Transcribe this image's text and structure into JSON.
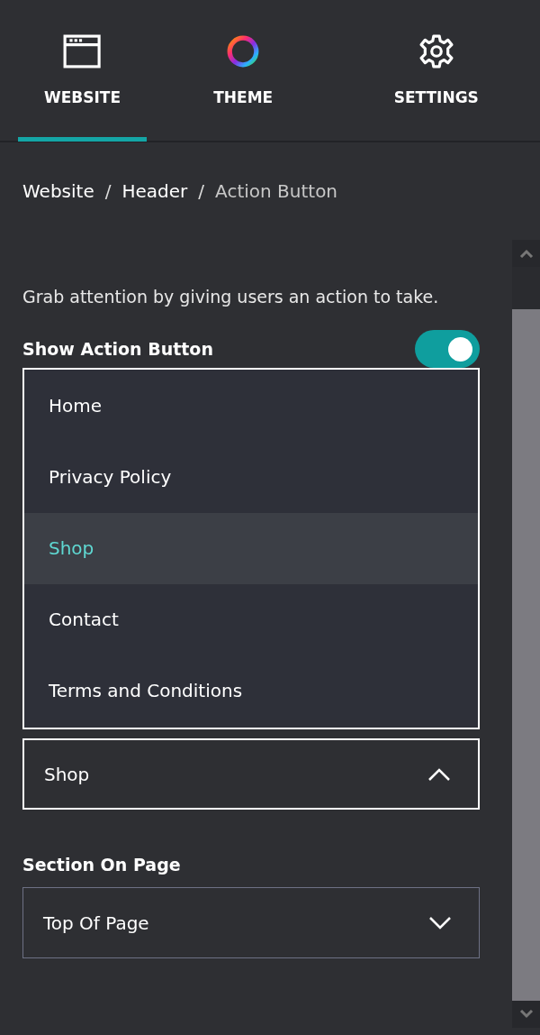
{
  "tabs": [
    {
      "label": "WEBSITE",
      "selected": true
    },
    {
      "label": "THEME",
      "selected": false
    },
    {
      "label": "SETTINGS",
      "selected": false
    }
  ],
  "breadcrumb": [
    {
      "label": "Website"
    },
    {
      "separator": "/",
      "label": "Header"
    },
    {
      "separator": "/",
      "label": "Action Button"
    }
  ],
  "description": "Grab attention by giving users an action to take.",
  "toggle": {
    "label": "Show Action Button",
    "on": true
  },
  "link_dropdown": {
    "expanded": true,
    "value": "Shop",
    "options": [
      {
        "label": "Home",
        "selected": false
      },
      {
        "label": "Privacy Policy",
        "selected": false
      },
      {
        "label": "Shop",
        "selected": true
      },
      {
        "label": "Contact",
        "selected": false
      },
      {
        "label": "Terms and Conditions",
        "selected": false
      }
    ]
  },
  "section_on_page": {
    "label": "Section On Page",
    "value": "Top Of Page",
    "expanded": false
  }
}
